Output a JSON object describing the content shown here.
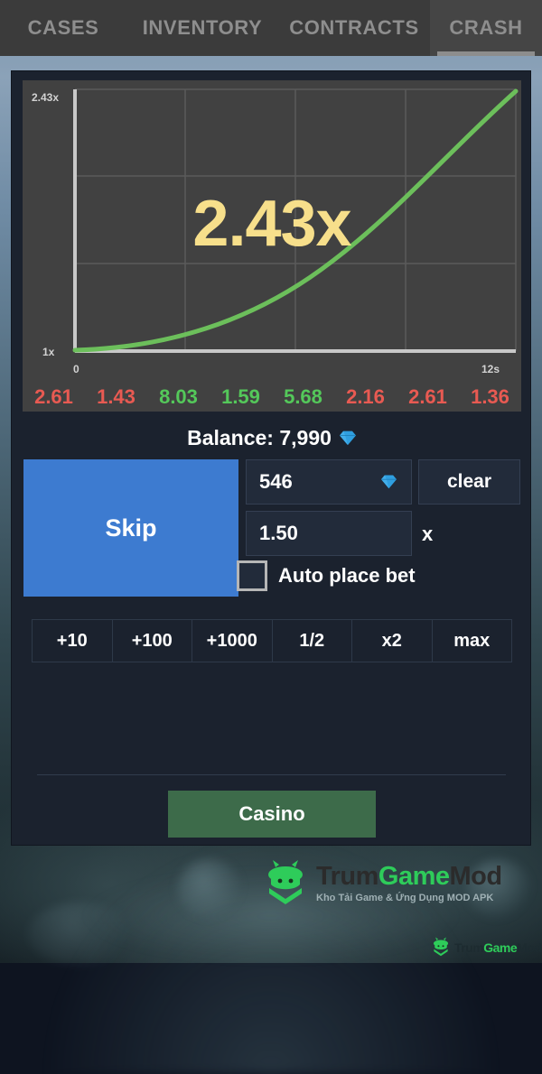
{
  "tabs": [
    {
      "label": "CASES",
      "active": false
    },
    {
      "label": "INVENTORY",
      "active": false
    },
    {
      "label": "CONTRACTS",
      "active": false
    },
    {
      "label": "CRASH",
      "active": true
    }
  ],
  "chart_data": {
    "type": "line",
    "title": "",
    "xlabel": "",
    "ylabel": "",
    "x_ticks": [
      "0",
      "12s"
    ],
    "y_ticks": [
      "1x",
      "2.43x"
    ],
    "xlim": [
      0,
      12
    ],
    "ylim": [
      1,
      2.43
    ],
    "grid": true,
    "grid_cols": 4,
    "grid_rows": 3,
    "legend": "none",
    "line_color": "#6cbf5b",
    "current_multiplier": "2.43x",
    "current_multiplier_value": 2.43,
    "elapsed_seconds": 12,
    "x": [
      0,
      1,
      2,
      3,
      4,
      5,
      6,
      7,
      8,
      9,
      10,
      11,
      12
    ],
    "y": [
      1.0,
      1.04,
      1.09,
      1.15,
      1.22,
      1.31,
      1.42,
      1.55,
      1.7,
      1.88,
      2.07,
      2.24,
      2.43
    ],
    "annotations": [
      "2.43x"
    ]
  },
  "history": [
    {
      "value": "2.61",
      "color": "#e85a52"
    },
    {
      "value": "1.43",
      "color": "#e85a52"
    },
    {
      "value": "8.03",
      "color": "#54c85a"
    },
    {
      "value": "1.59",
      "color": "#54c85a"
    },
    {
      "value": "5.68",
      "color": "#54c85a"
    },
    {
      "value": "2.16",
      "color": "#e85a52"
    },
    {
      "value": "2.61",
      "color": "#e85a52"
    },
    {
      "value": "1.36",
      "color": "#e85a52"
    }
  ],
  "balance": {
    "label": "Balance: 7,990",
    "amount": "7,990",
    "currency_icon": "gem-icon",
    "currency_color": "#2f9fe0"
  },
  "bet": {
    "skip_label": "Skip",
    "amount_value": "546",
    "amount_icon": "gem-icon",
    "clear_label": "clear",
    "cashout_value": "1.50",
    "cashout_suffix": "x",
    "autobet_label": "Auto place bet",
    "autobet_checked": false
  },
  "quick_bets": [
    {
      "label": "+10"
    },
    {
      "label": "+100"
    },
    {
      "label": "+1000"
    },
    {
      "label": "1/2"
    },
    {
      "label": "x2"
    },
    {
      "label": "max"
    }
  ],
  "footer": {
    "casino_label": "Casino",
    "casino_color": "#3d6b4a"
  },
  "watermark": {
    "title_part1": "Trum",
    "title_part2": "Game",
    "title_part3": "Mod",
    "subtitle": "Kho Tải Game & Ứng Dụng MOD APK"
  }
}
